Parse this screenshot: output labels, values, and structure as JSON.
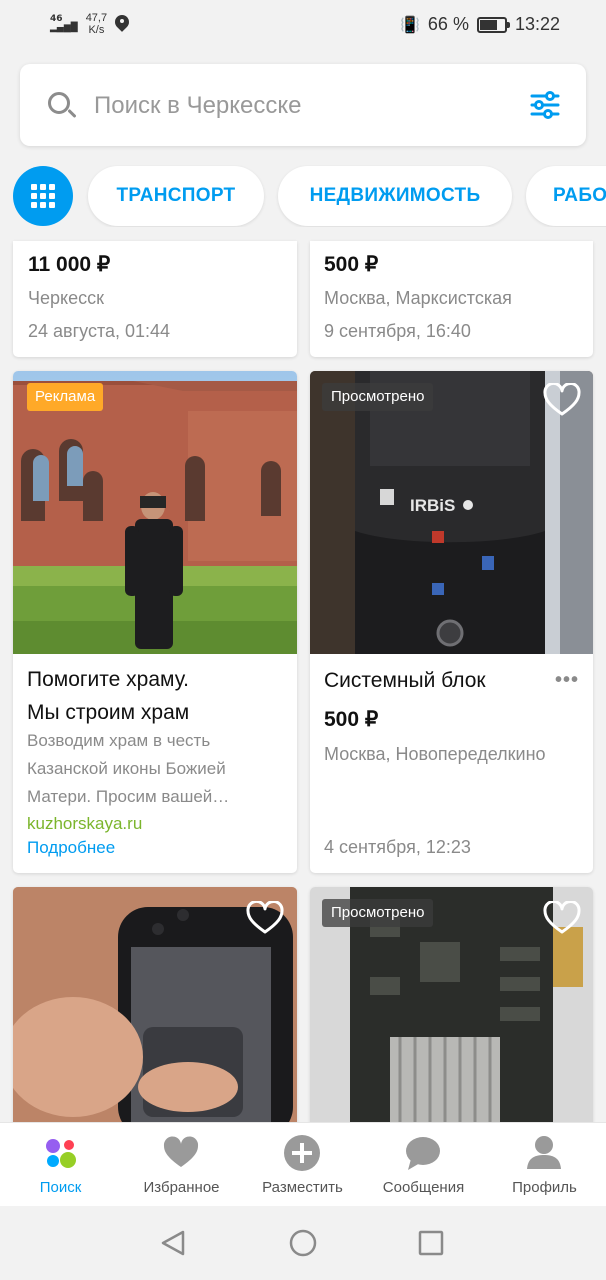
{
  "status_bar": {
    "network": "46",
    "speed_value": "47,7",
    "speed_unit": "K/s",
    "battery": "66 %",
    "time": "13:22"
  },
  "search": {
    "placeholder": "Поиск в Черкесске"
  },
  "categories": [
    "ТРАНСПОРТ",
    "НЕДВИЖИМОСТЬ",
    "РАБО"
  ],
  "cards_top": [
    {
      "price": "11 000 ₽",
      "location": "Черкесск",
      "date": "24 августа, 01:44"
    },
    {
      "price": "500 ₽",
      "location": "Москва, Марксистская",
      "date": "9 сентября, 16:40"
    }
  ],
  "ad_card": {
    "badge": "Реклама",
    "title_line1": "Помогите храму.",
    "title_line2": "Мы строим храм",
    "desc_line1": "Возводим храм в честь",
    "desc_line2": "Казанской иконы Божией",
    "desc_line3": "Матери. Просим вашей…",
    "domain": "kuzhorskaya.ru",
    "more": "Подробнее"
  },
  "item_card": {
    "badge": "Просмотрено",
    "title": "Системный блок",
    "price": "500 ₽",
    "location": "Москва, Новопеределкино",
    "date": "4 сентября, 12:23",
    "menu": "•••"
  },
  "bottom_cards": [
    {
      "badge": ""
    },
    {
      "badge": "Просмотрено"
    }
  ],
  "bottom_nav": [
    {
      "label": "Поиск",
      "icon": "search-tab-icon",
      "active": true
    },
    {
      "label": "Избранное",
      "icon": "heart-icon",
      "active": false
    },
    {
      "label": "Разместить",
      "icon": "plus-circle-icon",
      "active": false
    },
    {
      "label": "Сообщения",
      "icon": "chat-bubble-icon",
      "active": false
    },
    {
      "label": "Профиль",
      "icon": "person-icon",
      "active": false
    }
  ],
  "colors": {
    "accent": "#009cf0",
    "ad_badge": "#ffa928",
    "domain_green": "#7bb52c",
    "background": "#f2f2f2"
  }
}
